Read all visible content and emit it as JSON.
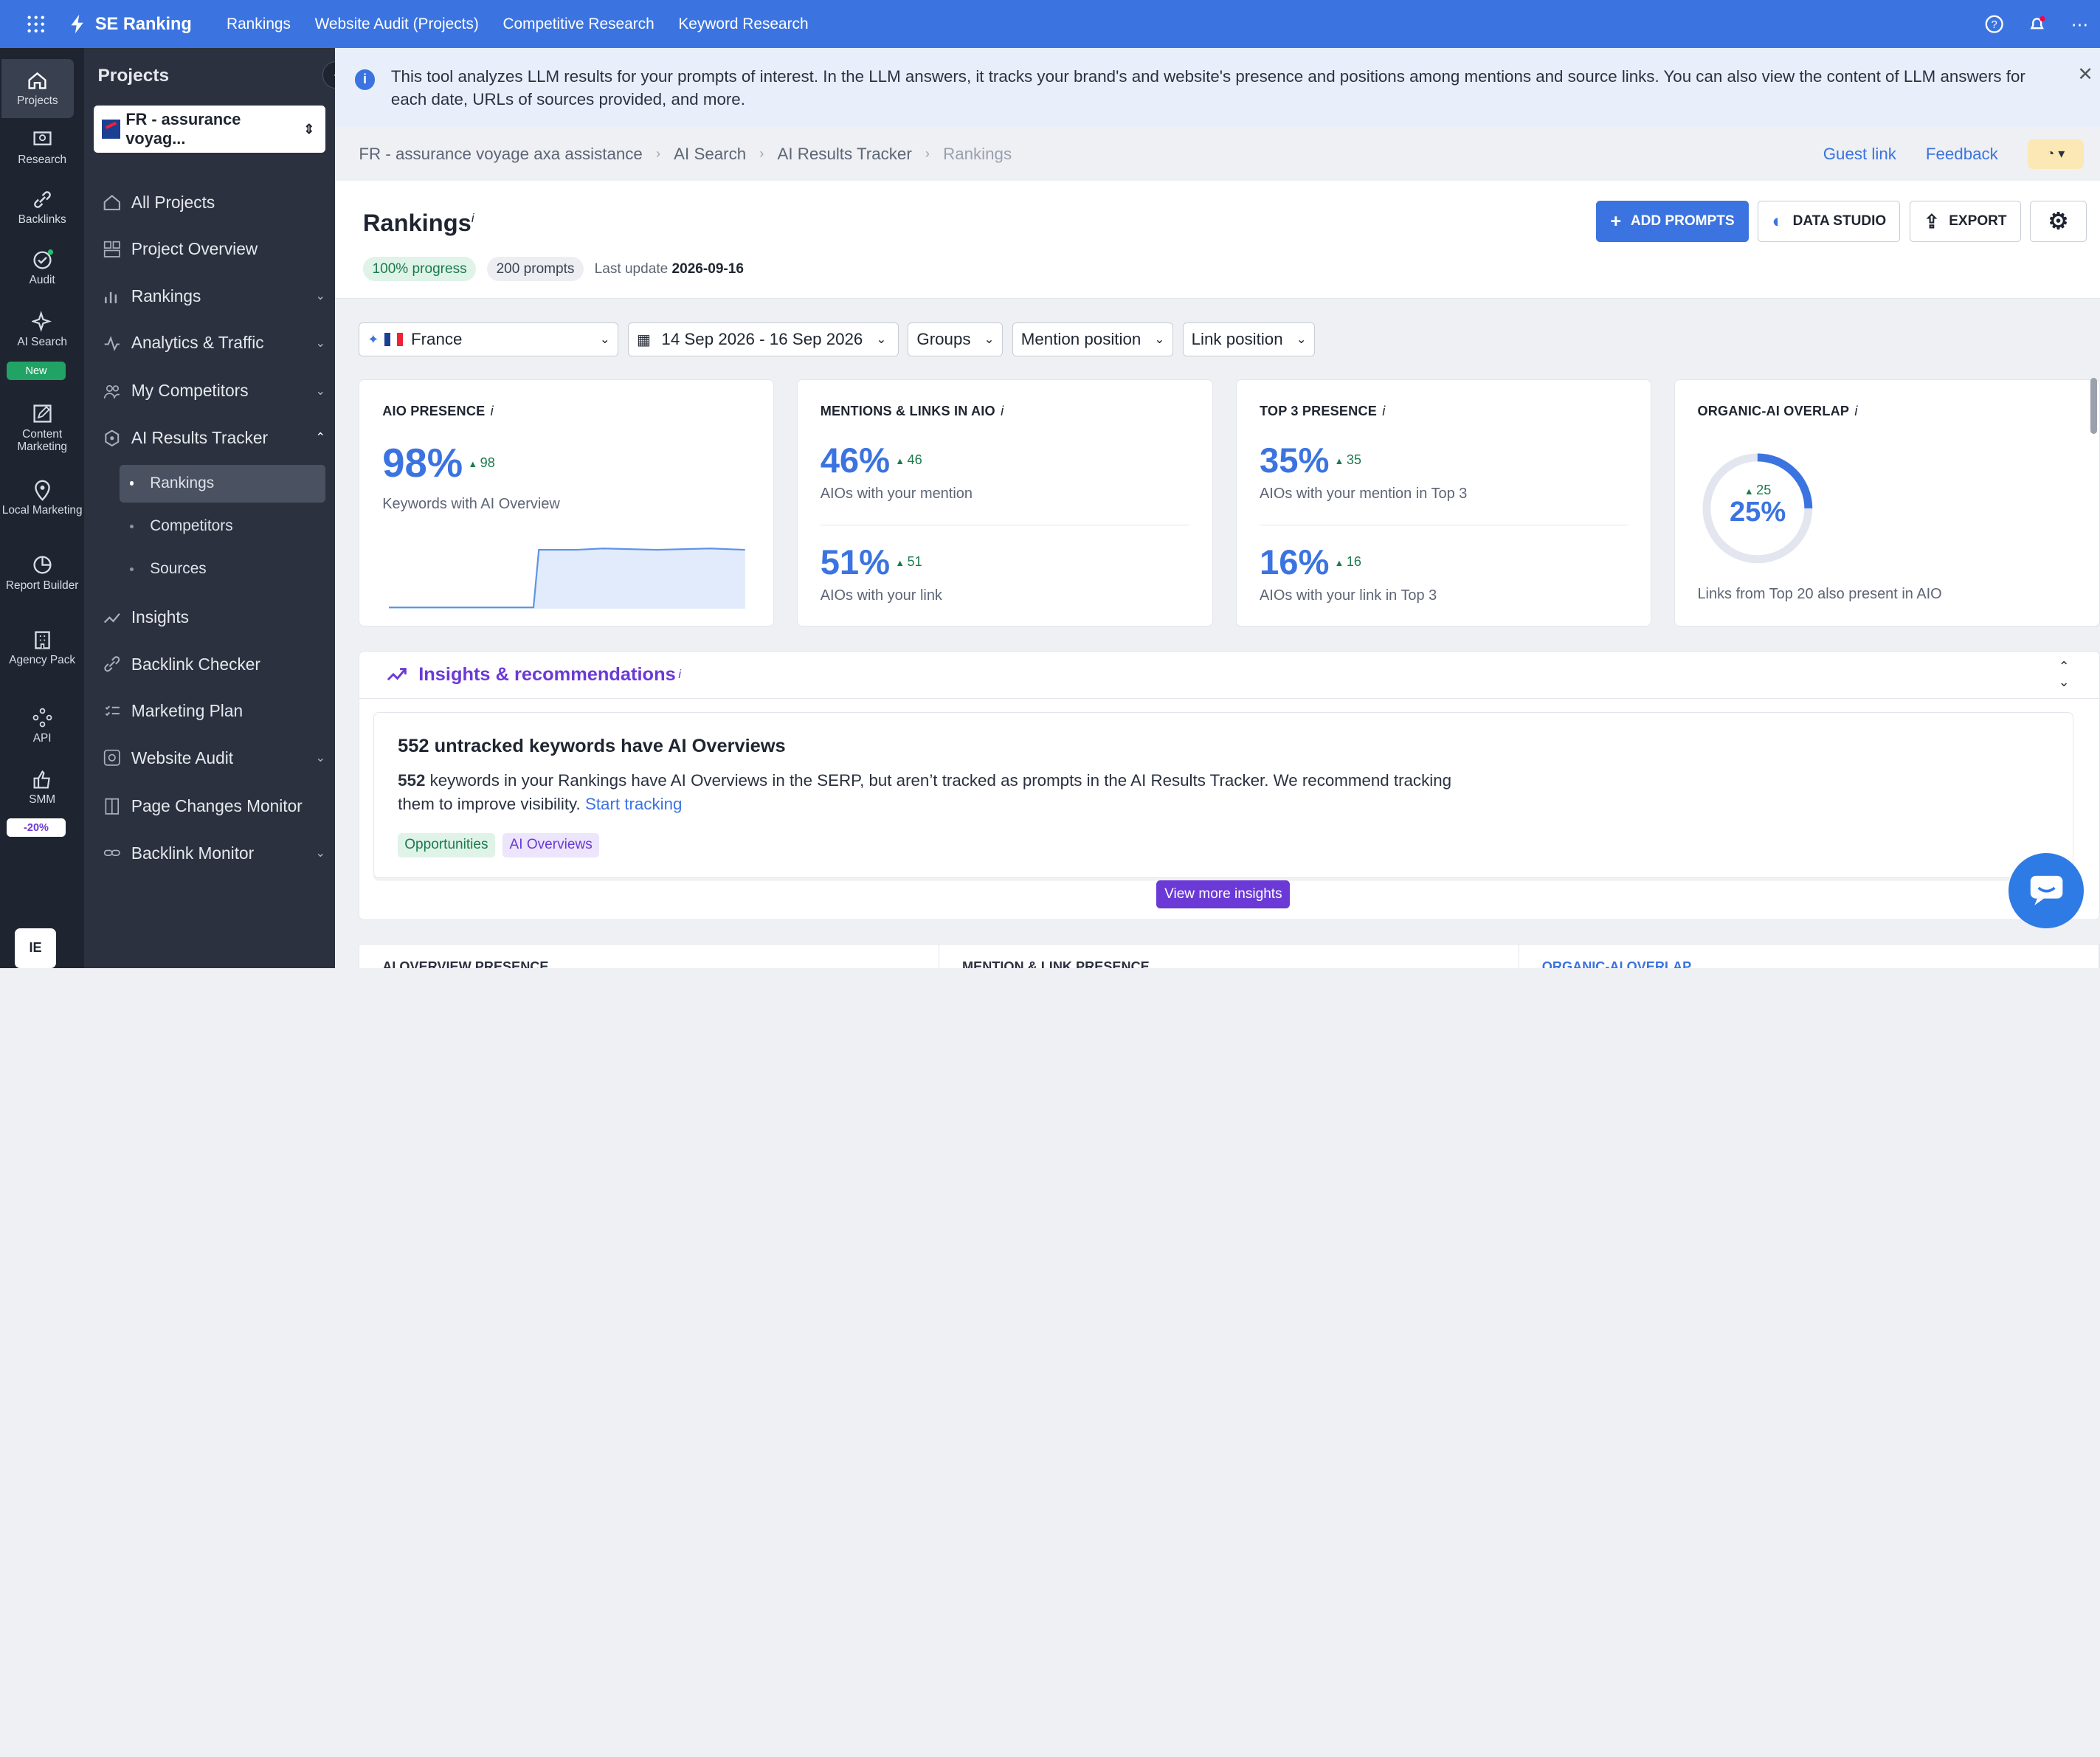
{
  "topbar": {
    "brand": "SE Ranking",
    "nav": [
      "Rankings",
      "Website Audit (Projects)",
      "Competitive Research",
      "Keyword Research"
    ]
  },
  "rail": {
    "items": [
      {
        "label": "Projects",
        "icon": "home-icon"
      },
      {
        "label": "Research",
        "icon": "research-icon"
      },
      {
        "label": "Backlinks",
        "icon": "link-icon"
      },
      {
        "label": "Audit",
        "icon": "audit-icon"
      },
      {
        "label": "AI Search",
        "icon": "sparkle-icon"
      },
      {
        "label": "Content Marketing",
        "icon": "edit-icon"
      },
      {
        "label": "Local Marketing",
        "icon": "pin-icon"
      },
      {
        "label": "Report Builder",
        "icon": "pie-icon"
      },
      {
        "label": "Agency Pack",
        "icon": "building-icon"
      },
      {
        "label": "API",
        "icon": "api-icon"
      },
      {
        "label": "SMM",
        "icon": "thumbs-up-icon"
      }
    ],
    "new_badge": "New",
    "discount_badge": "-20%",
    "avatar": "IE"
  },
  "sidebar": {
    "title": "Projects",
    "project": "FR - assurance voyag...",
    "items": [
      {
        "label": "All Projects"
      },
      {
        "label": "Project Overview"
      },
      {
        "label": "Rankings"
      },
      {
        "label": "Analytics & Traffic"
      },
      {
        "label": "My Competitors"
      },
      {
        "label": "AI Results Tracker"
      },
      {
        "label": "Insights"
      },
      {
        "label": "Backlink Checker"
      },
      {
        "label": "Marketing Plan"
      },
      {
        "label": "Website Audit"
      },
      {
        "label": "Page Changes Monitor"
      },
      {
        "label": "Backlink Monitor"
      }
    ],
    "subitems": [
      "Rankings",
      "Competitors",
      "Sources"
    ]
  },
  "banner": {
    "text": "This tool analyzes LLM results for your prompts of interest. In the LLM answers, it tracks your brand's and website's presence and positions among mentions and source links. You can also view the content of LLM answers for each date, URLs of sources provided, and more."
  },
  "breadcrumbs": [
    "FR - assurance voyage axa assistance",
    "AI Search",
    "AI Results Tracker",
    "Rankings"
  ],
  "header_links": {
    "guest": "Guest link",
    "feedback": "Feedback"
  },
  "page": {
    "title": "Rankings",
    "info": "i",
    "progress": "100% progress",
    "prompts": "200 prompts",
    "last_update_label": "Last update",
    "last_update": "2026-09-16",
    "buttons": {
      "add": "ADD PROMPTS",
      "studio": "DATA STUDIO",
      "export": "EXPORT"
    }
  },
  "filters": {
    "country": "France",
    "dates": "14 Sep 2026 - 16 Sep 2026",
    "groups": "Groups",
    "mention": "Mention position",
    "link": "Link position"
  },
  "cards": {
    "aio": {
      "title": "AIO PRESENCE",
      "value": "98%",
      "delta": "98",
      "sub": "Keywords with AI Overview"
    },
    "mentions": {
      "title": "MENTIONS & LINKS IN AIO",
      "v1": "46%",
      "d1": "46",
      "s1": "AIOs with your mention",
      "v2": "51%",
      "d2": "51",
      "s2": "AIOs with your link"
    },
    "top3": {
      "title": "TOP 3 PRESENCE",
      "v1": "35%",
      "d1": "35",
      "s1": "AIOs with your mention in Top 3",
      "v2": "16%",
      "d2": "16",
      "s2": "AIOs with your link in Top 3"
    },
    "overlap": {
      "title": "ORGANIC-AI OVERLAP",
      "value": "25%",
      "delta": "25",
      "percent": 25,
      "sub": "Links from Top 20 also present in AIO"
    }
  },
  "insights": {
    "title": "Insights & recommendations",
    "heading": "552 untracked keywords have AI Overviews",
    "count": "552",
    "body": " keywords in your Rankings have AI Overviews in the SERP, but aren’t tracked as prompts in the AI Results Tracker. We recommend tracking them to improve visibility. ",
    "link": "Start tracking",
    "tags": [
      "Opportunities",
      "AI Overviews"
    ],
    "more": "View more insights"
  },
  "bottom_tabs": [
    "AI OVERVIEW PRESENCE",
    "MENTION & LINK PRESENCE",
    "ORGANIC-AI OVERLAP"
  ],
  "colors": {
    "accent": "#3b74e0",
    "sidebar": "#2b313e",
    "rail": "#1f2530",
    "purple": "#6b3ad6",
    "green": "#1c7a4c"
  }
}
